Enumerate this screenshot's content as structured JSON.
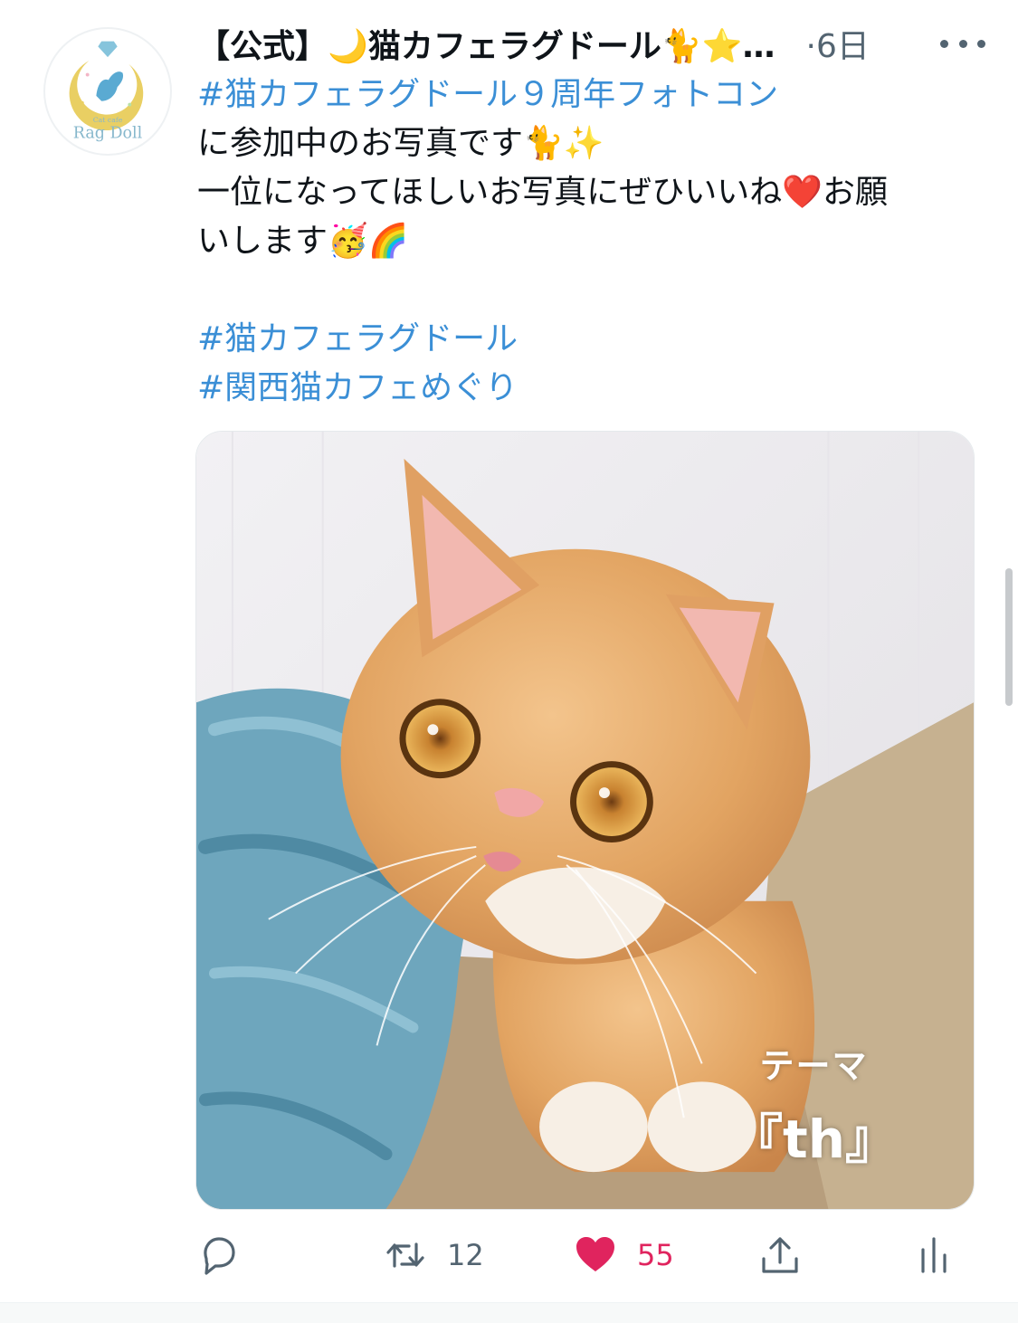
{
  "tweet": {
    "author": {
      "display_name": "【公式】🌙猫カフェラグドール🐈⭐…",
      "avatar_text": "Rag Doll",
      "avatar_small_text": "Cat cafe"
    },
    "separator": "·",
    "time": "6日",
    "more_icon": "more-dots-icon",
    "lines": {
      "hashtag_1": "#猫カフェラグドール９周年フォトコン",
      "line_2": "に参加中のお写真です🐈✨",
      "line_3": "一位になってほしいお写真にぜひいいね❤️お願",
      "line_4": "いします🥳🌈",
      "hashtag_2": "#猫カフェラグドール",
      "hashtag_3": "#関西猫カフェめぐり"
    },
    "photo": {
      "overlay_theme": "テーマ",
      "overlay_name": "『th』"
    },
    "actions": {
      "reply": {
        "icon": "reply-icon",
        "count": ""
      },
      "retweet": {
        "icon": "retweet-icon",
        "count": "12"
      },
      "like": {
        "icon": "heart-icon",
        "count": "55",
        "liked": true,
        "color": "#e0245e"
      },
      "share": {
        "icon": "share-icon",
        "count": ""
      },
      "analytics": {
        "icon": "analytics-icon",
        "count": ""
      }
    }
  },
  "colors": {
    "hashtag": "#3b8fd6",
    "text": "#0f1419",
    "secondary": "#536471",
    "like": "#e0245e"
  }
}
